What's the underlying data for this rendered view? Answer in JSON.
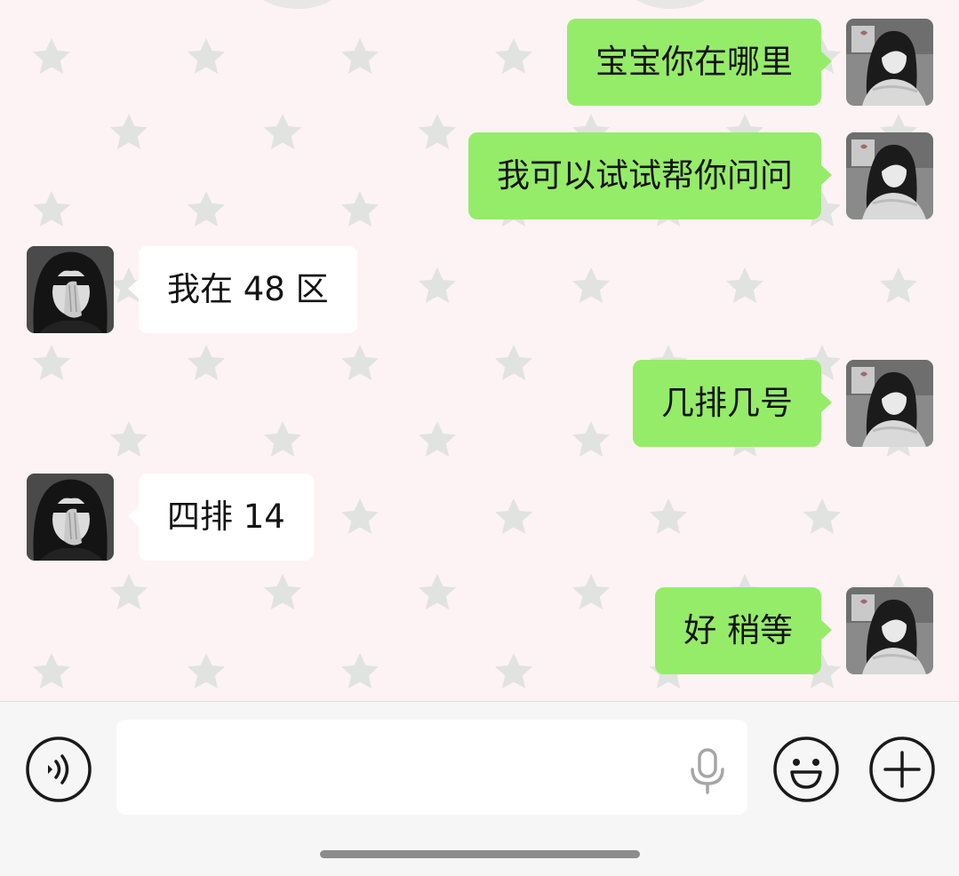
{
  "messages": [
    {
      "side": "out",
      "text": "宝宝你在哪里"
    },
    {
      "side": "out",
      "text": "我可以试试帮你问问"
    },
    {
      "side": "in",
      "text": "我在 48 区"
    },
    {
      "side": "out",
      "text": "几排几号"
    },
    {
      "side": "in",
      "text": "四排 14"
    },
    {
      "side": "out",
      "text": "好 稍等"
    }
  ],
  "colors": {
    "chat_background": "#fdf3f4",
    "star_color": "#e1e3e0",
    "sent_bubble": "#95ec69",
    "received_bubble": "#ffffff",
    "input_bar": "#f6f6f6"
  },
  "icons": {
    "voice_toggle": "voice-wave-icon",
    "mic": "microphone-icon",
    "emoji": "smiley-face-icon",
    "more": "plus-icon"
  },
  "input": {
    "value": ""
  }
}
